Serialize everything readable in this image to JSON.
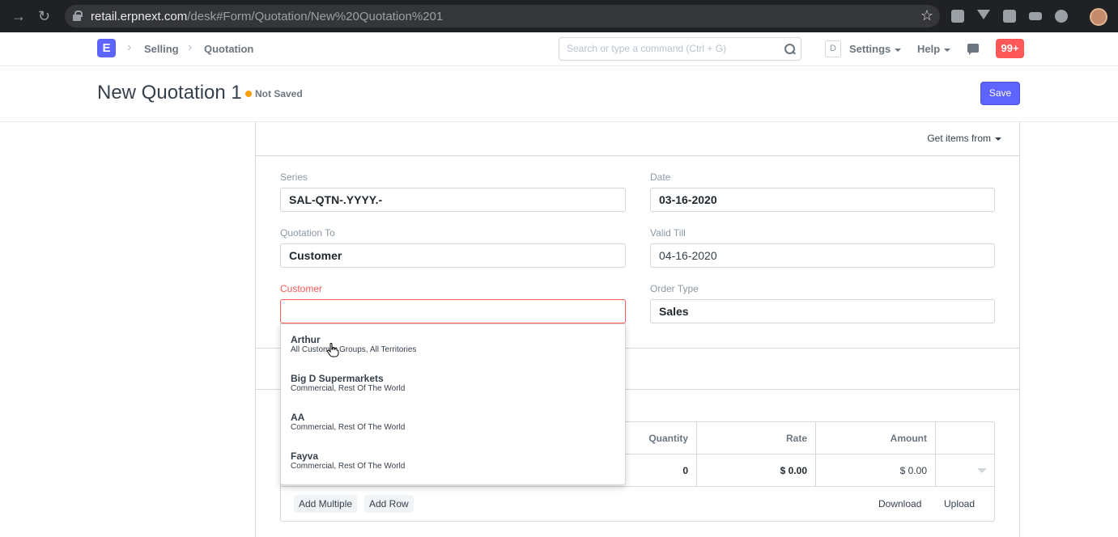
{
  "browser": {
    "url_host": "retail.erpnext.com",
    "url_path": "/desk#Form/Quotation/New%20Quotation%201"
  },
  "navbar": {
    "logo_letter": "E",
    "breadcrumbs": [
      "Selling",
      "Quotation"
    ],
    "search_placeholder": "Search or type a command (Ctrl + G)",
    "user_initial": "D",
    "settings_label": "Settings",
    "help_label": "Help",
    "notification_count": "99+"
  },
  "page": {
    "title": "New Quotation 1",
    "status": "Not Saved",
    "save_label": "Save"
  },
  "form": {
    "get_items_label": "Get items from",
    "fields": {
      "series": {
        "label": "Series",
        "value": "SAL-QTN-.YYYY.-"
      },
      "date": {
        "label": "Date",
        "value": "03-16-2020"
      },
      "quotation_to": {
        "label": "Quotation To",
        "value": "Customer"
      },
      "valid_till": {
        "label": "Valid Till",
        "value": "04-16-2020"
      },
      "customer": {
        "label": "Customer",
        "value": ""
      },
      "order_type": {
        "label": "Order Type",
        "value": "Sales"
      }
    }
  },
  "items_table": {
    "headers": {
      "quantity": "Quantity",
      "rate": "Rate",
      "amount": "Amount"
    },
    "row": {
      "quantity": "0",
      "rate": "$ 0.00",
      "amount": "$ 0.00"
    },
    "add_multiple_label": "Add Multiple",
    "add_row_label": "Add Row",
    "download_label": "Download",
    "upload_label": "Upload"
  },
  "customer_dropdown": [
    {
      "name": "Arthur",
      "desc": "All Customer Groups, All Territories"
    },
    {
      "name": "Big D Supermarkets",
      "desc": "Commercial, Rest Of The World"
    },
    {
      "name": "AA",
      "desc": "Commercial, Rest Of The World"
    },
    {
      "name": "Fayva",
      "desc": "Commercial, Rest Of The World"
    }
  ],
  "colors": {
    "primary": "#5e64ff",
    "error": "#ff5858",
    "warning": "#ff9f0a"
  }
}
